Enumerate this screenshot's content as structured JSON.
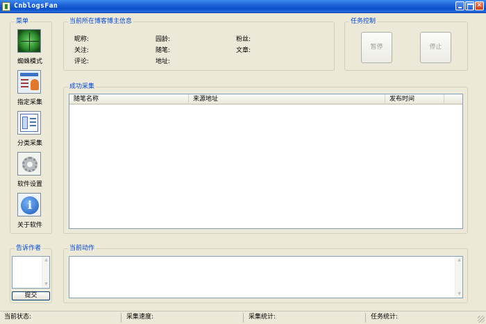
{
  "window": {
    "title": "CnblogsFan"
  },
  "menu": {
    "title": "菜单",
    "items": [
      {
        "label": "蜘蛛模式",
        "icon": "spider-radar-icon"
      },
      {
        "label": "指定采集",
        "icon": "user-card-icon"
      },
      {
        "label": "分类采集",
        "icon": "category-list-icon"
      },
      {
        "label": "软件设置",
        "icon": "gear-icon"
      },
      {
        "label": "关于软件",
        "icon": "info-icon"
      }
    ]
  },
  "blogger_info": {
    "title": "当前所在博客博主信息",
    "fields": {
      "nickname": "昵称:",
      "age": "园龄:",
      "fans": "粉丝:",
      "follow": "关注:",
      "essays": "随笔:",
      "articles": "文章:",
      "comments": "评论:",
      "address": "地址:"
    }
  },
  "task_control": {
    "title": "任务控制",
    "pause_label": "暂停",
    "stop_label": "停止"
  },
  "collected": {
    "title": "成功采集",
    "columns": [
      "随笔名称",
      "来源地址",
      "发布时间"
    ],
    "rows": []
  },
  "feedback": {
    "title": "告诉作者",
    "submit_label": "提交"
  },
  "current_action": {
    "title": "当前动作"
  },
  "status_bar": {
    "state": "当前状态:",
    "speed": "采集速度:",
    "collect_stats": "采集统计:",
    "task_stats": "任务统计:"
  },
  "colors": {
    "titlebar": "#0a4fc8",
    "group_title": "#0046d5",
    "background": "#ece9d8"
  }
}
